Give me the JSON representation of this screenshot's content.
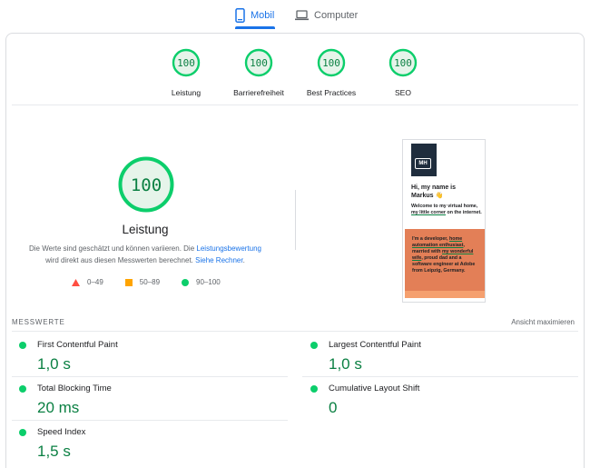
{
  "tabs": {
    "mobile": "Mobil",
    "computer": "Computer"
  },
  "categories": [
    {
      "score": "100",
      "label": "Leistung"
    },
    {
      "score": "100",
      "label": "Barrierefreiheit"
    },
    {
      "score": "100",
      "label": "Best Practices"
    },
    {
      "score": "100",
      "label": "SEO"
    }
  ],
  "performance": {
    "score": "100",
    "title": "Leistung",
    "desc_part1": "Die Werte sind geschätzt und können variieren. Die ",
    "desc_link1": "Leistungsbewertung",
    "desc_part2": "wird direkt aus diesen Messwerten berechnet. ",
    "desc_link2": "Siehe Rechner",
    "desc_end": "."
  },
  "legend": {
    "fail": "0–49",
    "average": "50–89",
    "pass": "90–100"
  },
  "preview": {
    "logo": "MH",
    "hi_line1": "Hi, my name is",
    "hi_line2": "Markus 👋",
    "welcome_a": "Welcome to my virtual home, ",
    "welcome_link": "my little corner",
    "welcome_b": " on the internet.",
    "bio_a": "I'm a developer, ",
    "bio_link1": "home automation enthusiast",
    "bio_b": ", married with ",
    "bio_link2": "my wonderful wife",
    "bio_c": ", proud dad and a software engineer at Adobe from Leipzig, Germany."
  },
  "metrics": {
    "section_label": "MESSWERTE",
    "expand_label": "Ansicht maximieren",
    "items": [
      {
        "name": "First Contentful Paint",
        "value": "1,0 s"
      },
      {
        "name": "Largest Contentful Paint",
        "value": "1,0 s"
      },
      {
        "name": "Total Blocking Time",
        "value": "20 ms"
      },
      {
        "name": "Cumulative Layout Shift",
        "value": "0"
      },
      {
        "name": "Speed Index",
        "value": "1,5 s"
      }
    ]
  },
  "colors": {
    "accent": "#1a73e8",
    "pass": "#0cce6b",
    "pass_text": "#0b8043",
    "average": "#ffa400",
    "fail": "#ff4e42",
    "ring_bg": "#e6f4ea"
  }
}
